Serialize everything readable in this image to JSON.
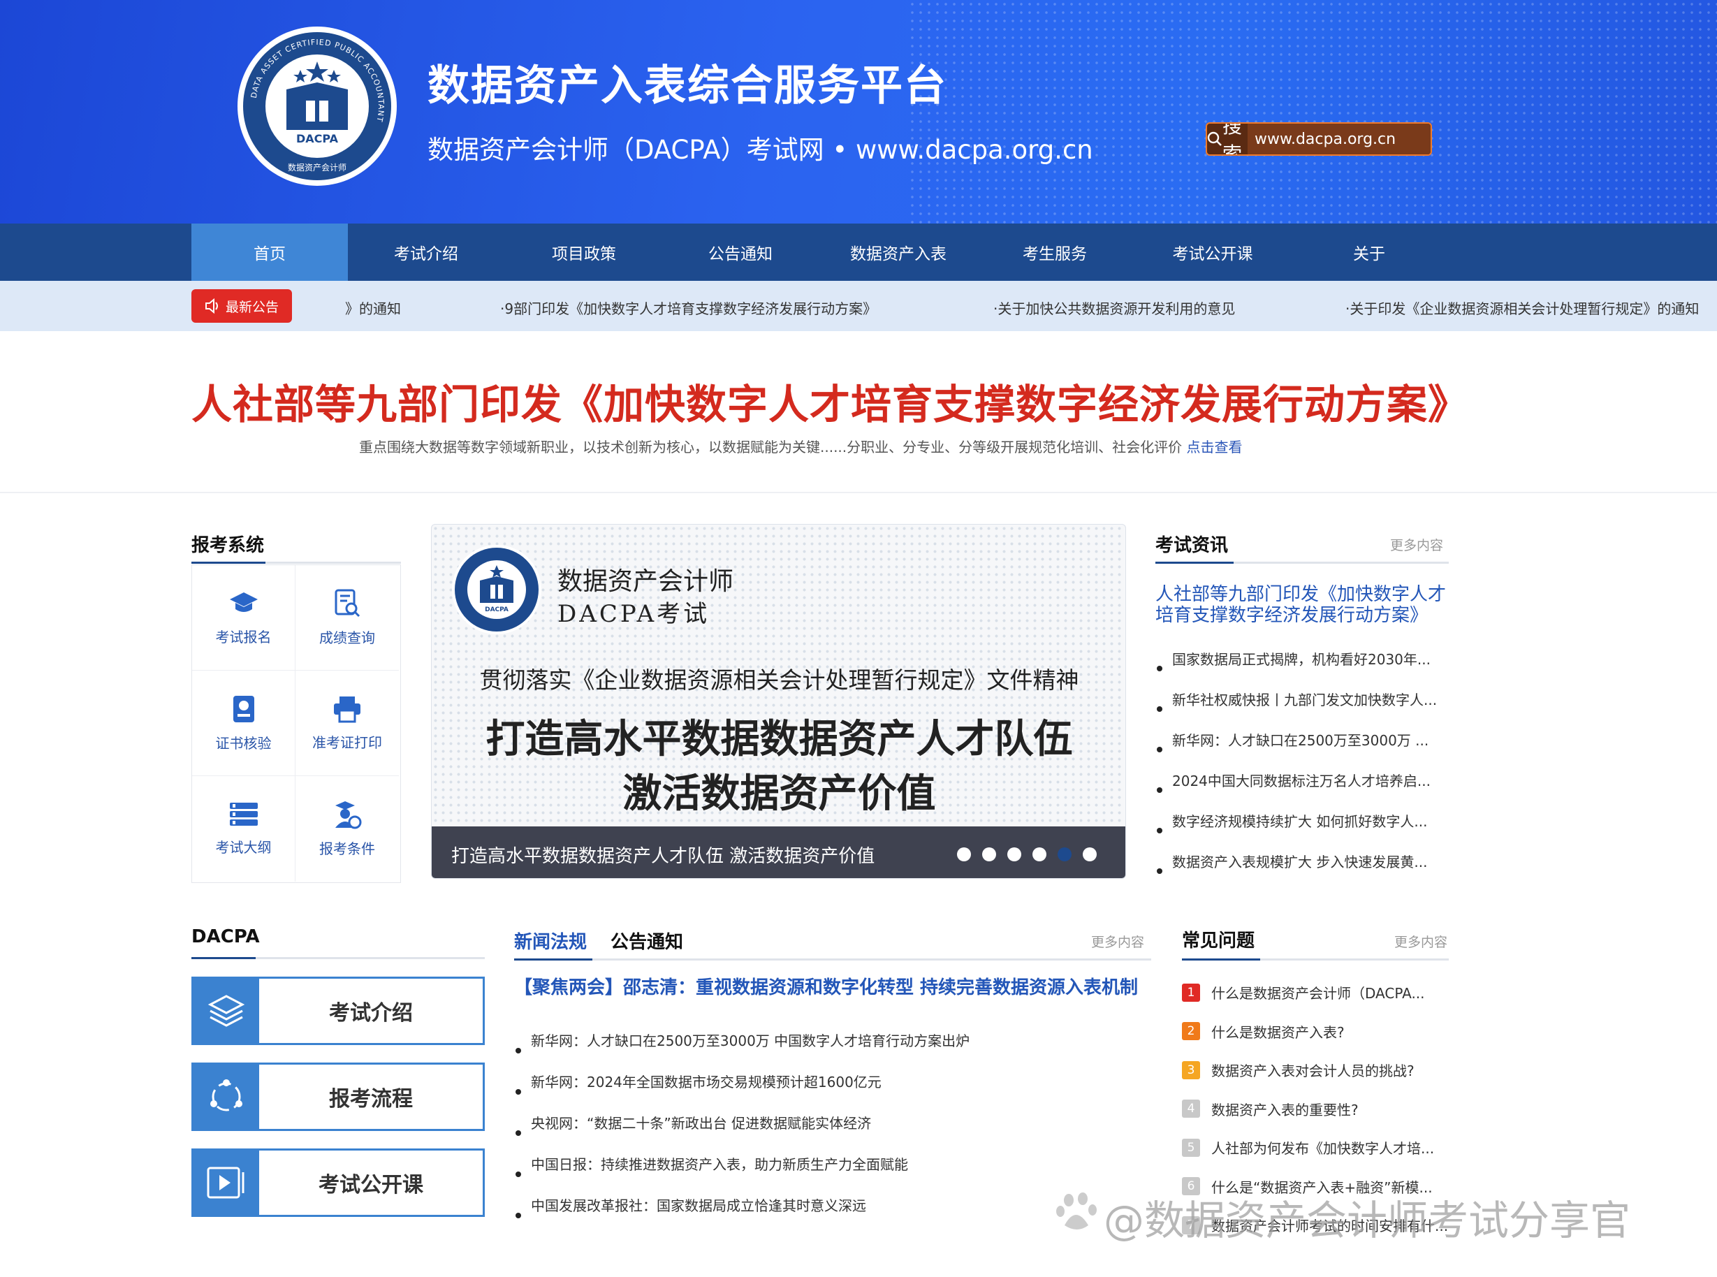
{
  "header": {
    "title": "数据资产入表综合服务平台",
    "subtitle": "数据资产会计师（DACPA）考试网 • www.dacpa.org.cn",
    "search_label": "搜索",
    "search_value": "www.dacpa.org.cn",
    "logo_text": "DACPA",
    "logo_ring_text": "DATA ASSET CERTIFIED PUBLIC ACCOUNTANT",
    "logo_cn_text": "数据资产会计师"
  },
  "nav": [
    "首页",
    "考试介绍",
    "项目政策",
    "公告通知",
    "数据资产入表",
    "考生服务",
    "考试公开课",
    "关于"
  ],
  "ticker": {
    "badge": "最新公告",
    "items": [
      "》的通知",
      "·9部门印发《加快数字人才培育支撑数字经济发展行动方案》",
      "·关于加快公共数据资源开发利用的意见",
      "·关于印发《企业数据资源相关会计处理暂行规定》的通知"
    ]
  },
  "headline": {
    "title": "人社部等九部门印发《加快数字人才培育支撑数字经济发展行动方案》",
    "summary": "重点围绕大数据等数字领域新职业，以技术创新为核心，以数据赋能为关键......分职业、分专业、分等级开展规范化培训、社会化评价",
    "link": "点击查看"
  },
  "services": {
    "title": "报考系统",
    "items": [
      {
        "label": "考试报名",
        "icon": "graduation-cap-icon"
      },
      {
        "label": "成绩查询",
        "icon": "document-search-icon"
      },
      {
        "label": "证书核验",
        "icon": "certificate-icon"
      },
      {
        "label": "准考证打印",
        "icon": "printer-icon"
      },
      {
        "label": "考试大纲",
        "icon": "outline-list-icon"
      },
      {
        "label": "报考条件",
        "icon": "candidate-icon"
      }
    ]
  },
  "carousel": {
    "brand_line1": "数据资产会计师",
    "brand_line2": "DACPA考试",
    "line1": "贯彻落实《企业数据资源相关会计处理暂行规定》文件精神",
    "line2": "打造高水平数据数据资产人才队伍",
    "line3": "激活数据资产价值",
    "caption": "打造高水平数据数据资产人才队伍 激活数据资产价值",
    "dot_count": 6,
    "active_dot": 5
  },
  "exam_news": {
    "title": "考试资讯",
    "more": "更多内容",
    "lead": "人社部等九部门印发《加快数字人才培育支撑数字经济发展行动方案》",
    "items": [
      "国家数据局正式揭牌，机构看好2030年...",
      "新华社权威快报丨九部门发文加快数字人...",
      "新华网：人才缺口在2500万至3000万 ...",
      "2024中国大同数据标注万名人才培养启...",
      "数字经济规模持续扩大 如何抓好数字人...",
      "数据资产入表规模扩大 步入快速发展黄..."
    ]
  },
  "dacpa": {
    "title": "DACPA",
    "buttons": [
      {
        "label": "考试介绍",
        "icon": "layers-icon"
      },
      {
        "label": "报考流程",
        "icon": "process-cycle-icon"
      },
      {
        "label": "考试公开课",
        "icon": "video-play-icon"
      }
    ]
  },
  "mid_news": {
    "tab_active": "新闻法规",
    "tab_other": "公告通知",
    "more": "更多内容",
    "lead": "【聚焦两会】邵志清：重视数据资源和数字化转型 持续完善数据资源入表机制",
    "items": [
      "新华网：人才缺口在2500万至3000万 中国数字人才培育行动方案出炉",
      "新华网：2024年全国数据市场交易规模预计超1600亿元",
      "央视网：“数据二十条”新政出台 促进数据赋能实体经济",
      "中国日报：持续推进数据资产入表，助力新质生产力全面赋能",
      "中国发展改革报社：国家数据局成立恰逢其时意义深远"
    ]
  },
  "faq": {
    "title": "常见问题",
    "more": "更多内容",
    "items": [
      {
        "num": "1",
        "text": "什么是数据资产会计师（DACPA...",
        "color": "#e02a25"
      },
      {
        "num": "2",
        "text": "什么是数据资产入表?",
        "color": "#f07a1a"
      },
      {
        "num": "3",
        "text": "数据资产入表对会计人员的挑战?",
        "color": "#f5a623"
      },
      {
        "num": "4",
        "text": "数据资产入表的重要性?",
        "color": "#c8c8c8"
      },
      {
        "num": "5",
        "text": "人社部为何发布《加快数字人才培...",
        "color": "#c8c8c8"
      },
      {
        "num": "6",
        "text": "什么是“数据资产入表+融资”新模...",
        "color": "#c8c8c8"
      },
      {
        "num": "7",
        "text": "数据资产会计师考试的时间安排有什...",
        "color": "#c8c8c8"
      }
    ]
  },
  "watermark": "@数据资产会计师考试分享官",
  "colors": {
    "brand_blue": "#1d4a8e",
    "headline_red": "#d42a1e",
    "link_blue": "#2356b8"
  }
}
